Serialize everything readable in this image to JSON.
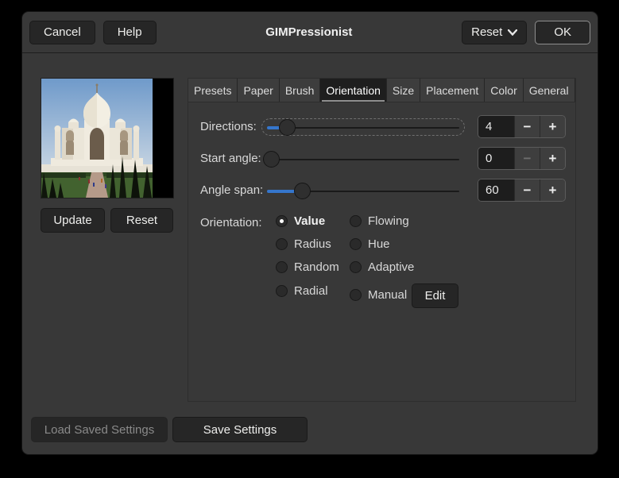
{
  "header": {
    "cancel_label": "Cancel",
    "help_label": "Help",
    "title": "GIMPressionist",
    "reset_label": "Reset",
    "ok_label": "OK"
  },
  "preview": {
    "update_label": "Update",
    "reset_label": "Reset"
  },
  "tabs": {
    "items": [
      "Presets",
      "Paper",
      "Brush",
      "Orientation",
      "Size",
      "Placement",
      "Color",
      "General"
    ],
    "active": "Orientation"
  },
  "orientation_tab": {
    "sliders": [
      {
        "label": "Directions:",
        "value": "4"
      },
      {
        "label": "Start angle:",
        "value": "0"
      },
      {
        "label": "Angle span:",
        "value": "60"
      }
    ],
    "icons": {
      "minus": "−",
      "plus": "+"
    },
    "orientation_label": "Orientation:",
    "radios": [
      "Value",
      "Radius",
      "Random",
      "Radial",
      "Flowing",
      "Hue",
      "Adaptive",
      "Manual"
    ],
    "selected_radio": "Value",
    "edit_label": "Edit"
  },
  "footer": {
    "load_label": "Load Saved Settings",
    "save_label": "Save Settings"
  },
  "colors": {
    "accent_blue": "#3576cc",
    "dialog_bg": "#383838",
    "entry_bg": "#1d1d1d"
  }
}
